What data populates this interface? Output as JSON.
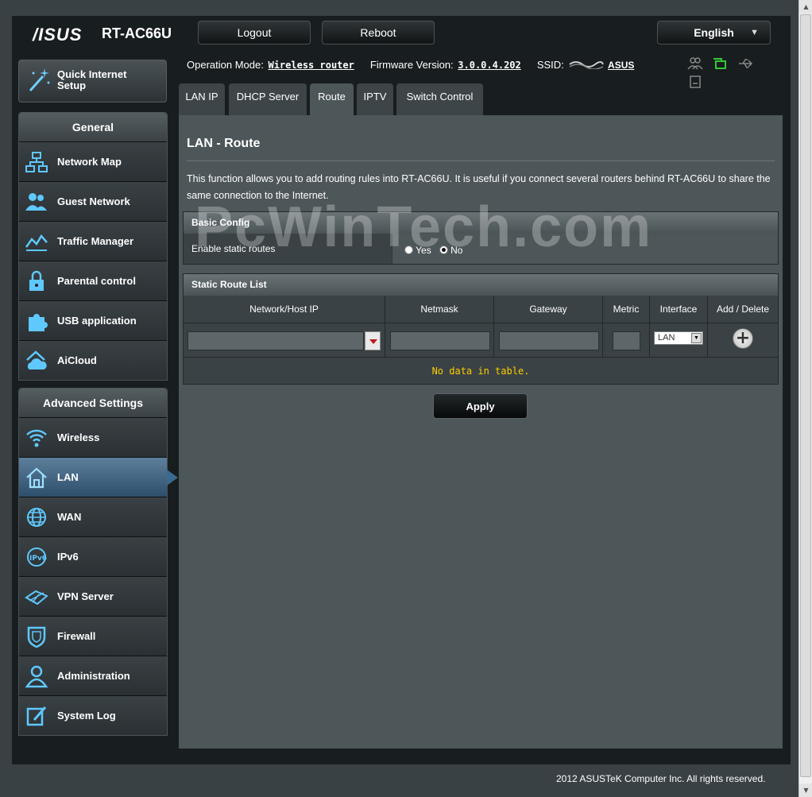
{
  "header": {
    "brand": "/ISUS",
    "model": "RT-AC66U",
    "logout_label": "Logout",
    "reboot_label": "Reboot",
    "language": "English"
  },
  "status": {
    "op_mode_label": "Operation Mode:",
    "op_mode_value": "Wireless router",
    "firmware_label": "Firmware Version:",
    "firmware_value": "3.0.0.4.202",
    "ssid_label": "SSID:",
    "ssid_value": "ASUS",
    "icons": [
      "clients-icon",
      "network-status-icon",
      "usb-icon",
      "printer-icon"
    ]
  },
  "sidebar": {
    "quick_setup": "Quick Internet Setup",
    "general_heading": "General",
    "general_items": [
      {
        "label": "Network Map",
        "icon": "network-map-icon"
      },
      {
        "label": "Guest Network",
        "icon": "guest-network-icon"
      },
      {
        "label": "Traffic Manager",
        "icon": "traffic-manager-icon"
      },
      {
        "label": "Parental control",
        "icon": "parental-control-icon"
      },
      {
        "label": "USB application",
        "icon": "usb-application-icon"
      },
      {
        "label": "AiCloud",
        "icon": "aicloud-icon"
      }
    ],
    "advanced_heading": "Advanced Settings",
    "advanced_items": [
      {
        "label": "Wireless",
        "icon": "wireless-icon"
      },
      {
        "label": "LAN",
        "icon": "lan-home-icon",
        "active": true
      },
      {
        "label": "WAN",
        "icon": "wan-globe-icon"
      },
      {
        "label": "IPv6",
        "icon": "ipv6-icon"
      },
      {
        "label": "VPN Server",
        "icon": "vpn-server-icon"
      },
      {
        "label": "Firewall",
        "icon": "firewall-icon"
      },
      {
        "label": "Administration",
        "icon": "administration-icon"
      },
      {
        "label": "System Log",
        "icon": "system-log-icon"
      }
    ]
  },
  "tabs": [
    {
      "label": "LAN IP"
    },
    {
      "label": "DHCP Server"
    },
    {
      "label": "Route",
      "active": true
    },
    {
      "label": "IPTV"
    },
    {
      "label": "Switch Control"
    }
  ],
  "main": {
    "title": "LAN - Route",
    "description": "This function allows you to add routing rules into RT-AC66U. It is useful if you connect several routers behind RT-AC66U to share the same connection to the Internet.",
    "basic_config": {
      "heading": "Basic Config",
      "enable_label": "Enable static routes",
      "yes_label": "Yes",
      "no_label": "No",
      "selected": "No"
    },
    "route_list": {
      "heading": "Static Route List",
      "columns": [
        "Network/Host IP",
        "Netmask",
        "Gateway",
        "Metric",
        "Interface",
        "Add / Delete"
      ],
      "interface_value": "LAN",
      "empty_message": "No data in table."
    },
    "apply_label": "Apply"
  },
  "watermark": "PcWinTech.com",
  "footer": "2012 ASUSTeK Computer Inc. All rights reserved."
}
